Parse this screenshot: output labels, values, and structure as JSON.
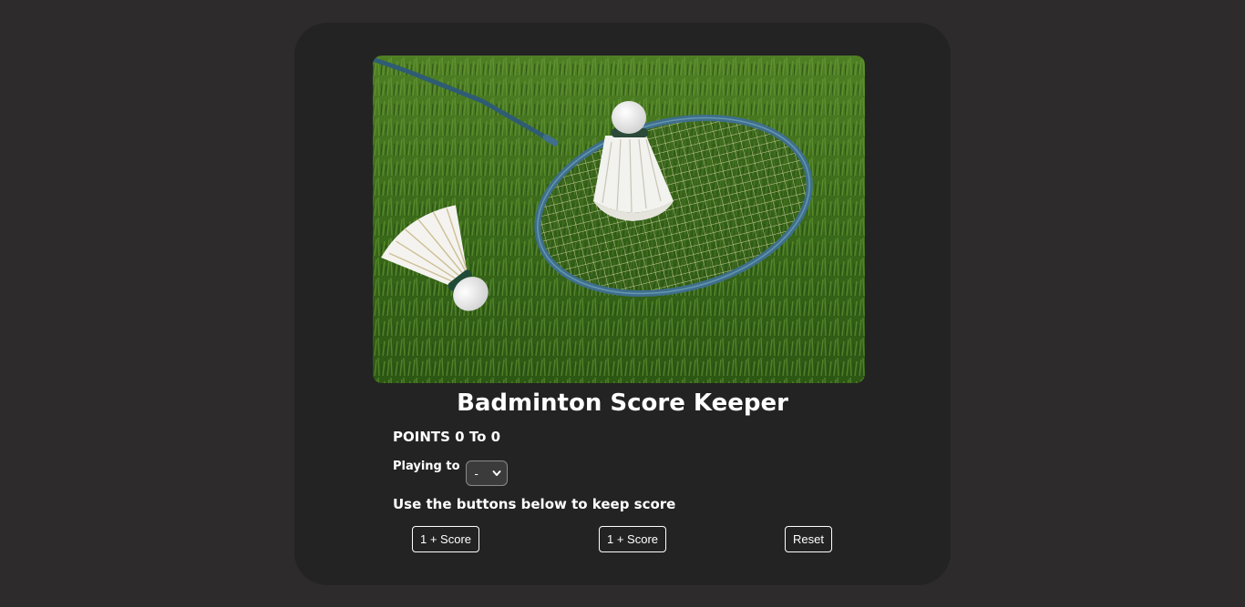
{
  "title": "Badminton Score Keeper",
  "points": {
    "label": "POINTS",
    "player1": "0",
    "separator": "To",
    "player2": "0"
  },
  "playing_to": {
    "label": "Playing to",
    "selected": "-"
  },
  "hint": "Use the buttons below to keep score",
  "buttons": {
    "player1_score": "1 + Score",
    "player2_score": "1 + Score",
    "reset": "Reset"
  },
  "image": {
    "subject": "badminton racket and shuttlecocks on grass"
  },
  "colors": {
    "page_background": "#2d2b2c",
    "card_background": "#232323",
    "text": "#ffffff",
    "grass": "#3d6b1c",
    "racket_frame": "#3f6f8c"
  }
}
